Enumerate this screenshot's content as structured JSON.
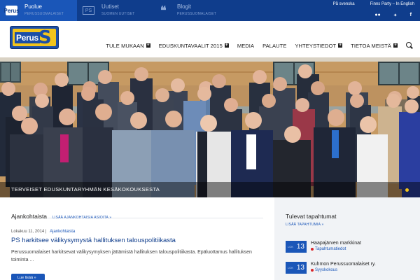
{
  "topbar": {
    "items": [
      {
        "title": "Puolue",
        "sub": "PERUSSUOMALAISET",
        "icon": "perus-logo-icon"
      },
      {
        "title": "Uutiset",
        "sub": "SUOMEN UUTISET",
        "icon": "ps-badge-icon"
      },
      {
        "title": "Blogit",
        "sub": "PERUSSUOMALAISET",
        "icon": "quote-icon"
      }
    ],
    "lang_sv": "På svenska",
    "lang_en": "Finns Party – In English",
    "social": [
      "flickr-icon",
      "twitter-icon",
      "facebook-icon"
    ],
    "logo_text": "Perus"
  },
  "header": {
    "logo_word": "Perus",
    "logo_letter": "S",
    "nav": [
      {
        "label": "TULE MUKAAN",
        "plus": true
      },
      {
        "label": "EDUSKUNTAVAALIT 2015",
        "plus": true
      },
      {
        "label": "MEDIA",
        "plus": false
      },
      {
        "label": "PALAUTE",
        "plus": false
      },
      {
        "label": "YHTEYSTIEDOT",
        "plus": true
      },
      {
        "label": "TIETOA MEISTÄ",
        "plus": true
      }
    ]
  },
  "hero": {
    "caption": "TERVEISET EDUSKUNTARYHMÄN KESÄKOKOUKSESTA"
  },
  "news": {
    "title": "Ajankohtaista",
    "link": "LISÄÄ AJANKOHTAISIA ASIOITA »",
    "date": "Lokakuu 11, 2014 |",
    "category": "Ajankohtaista",
    "headline": "PS harkitsee välikysymystä hallituksen talouspolitiikasta",
    "excerpt": "Perussuomalaiset harkitsevat välikysymyksen jättämistä hallituksen talouspolitiikasta. Epäluottamus hallituksen toiminta ...",
    "read_more": "Lue lisää »"
  },
  "events": {
    "title": "Tulevat tapahtumat",
    "link": "LISÄÄ TAPAHTUMIA »",
    "items": [
      {
        "month": "LOK",
        "day": "13",
        "name": "Haapajärven markkinat",
        "place": "Tapahtumatiedot",
        "sub": ""
      },
      {
        "month": "LOK",
        "day": "13",
        "name": "Kuhmon Perussuomalaiset ry.",
        "place": "Syyskokous",
        "sub": ""
      }
    ]
  },
  "colors": {
    "brand_blue": "#0f3d8c",
    "accent_blue": "#1a56b8",
    "logo_yellow": "#f2c41b"
  }
}
